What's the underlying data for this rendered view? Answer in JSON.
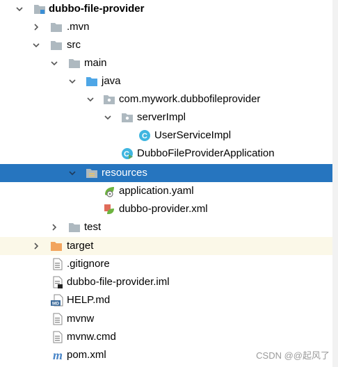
{
  "tree": [
    {
      "label": "dubbo-file-provider",
      "icon": "module-folder-icon",
      "expanded": true
    },
    {
      "label": ".mvn",
      "icon": "folder-icon",
      "expanded": false
    },
    {
      "label": "src",
      "icon": "folder-icon",
      "expanded": true
    },
    {
      "label": "main",
      "icon": "folder-icon",
      "expanded": true
    },
    {
      "label": "java",
      "icon": "source-root-folder-icon",
      "expanded": true
    },
    {
      "label": "com.mywork.dubbofileprovider",
      "icon": "package-icon",
      "expanded": true
    },
    {
      "label": "serverImpl",
      "icon": "package-icon",
      "expanded": true
    },
    {
      "label": "UserServiceImpl",
      "icon": "class-icon"
    },
    {
      "label": "DubboFileProviderApplication",
      "icon": "spring-boot-class-icon"
    },
    {
      "label": "resources",
      "icon": "resources-folder-icon",
      "expanded": true,
      "selected": true
    },
    {
      "label": "application.yaml",
      "icon": "spring-config-icon"
    },
    {
      "label": "dubbo-provider.xml",
      "icon": "spring-xml-icon"
    },
    {
      "label": "test",
      "icon": "folder-icon",
      "expanded": false
    },
    {
      "label": "target",
      "icon": "excluded-folder-icon",
      "expanded": false,
      "highlighted": true
    },
    {
      "label": ".gitignore",
      "icon": "text-file-icon"
    },
    {
      "label": "dubbo-file-provider.iml",
      "icon": "iml-file-icon"
    },
    {
      "label": "HELP.md",
      "icon": "markdown-file-icon"
    },
    {
      "label": "mvnw",
      "icon": "text-file-icon"
    },
    {
      "label": "mvnw.cmd",
      "icon": "text-file-icon"
    },
    {
      "label": "pom.xml",
      "icon": "maven-icon"
    }
  ],
  "watermark": "CSDN @@起风了",
  "colors": {
    "selection": "#2675bf",
    "highlight": "#fbf8e8",
    "folder": "#aeb9c0",
    "class": "#40b6e0",
    "excluded": "#f2a55e"
  }
}
